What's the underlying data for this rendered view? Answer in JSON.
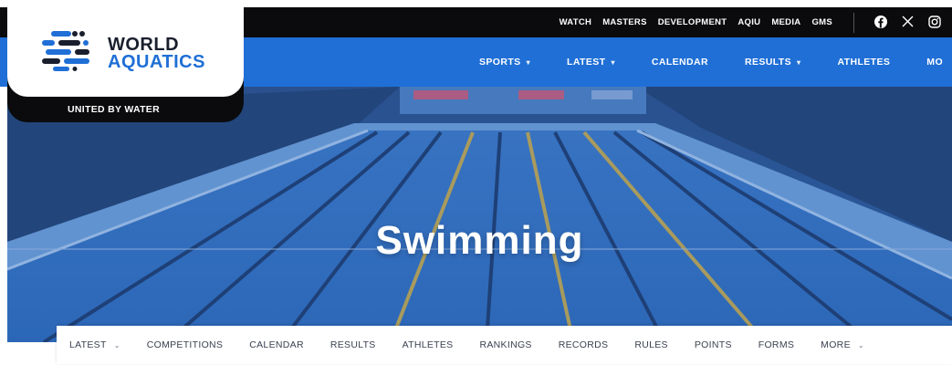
{
  "brand": {
    "name_line1": "WORLD",
    "name_line2": "AQUATICS",
    "tagline": "UNITED BY WATER"
  },
  "top_links": [
    "WATCH",
    "MASTERS",
    "DEVELOPMENT",
    "AQIU",
    "MEDIA",
    "GMS"
  ],
  "social": [
    {
      "name": "facebook-icon",
      "glyph": "f"
    },
    {
      "name": "x-icon",
      "glyph": "𝕏"
    },
    {
      "name": "instagram-icon",
      "glyph": "◎"
    }
  ],
  "main_nav": {
    "sports": "SPORTS",
    "latest": "LATEST",
    "calendar": "CALENDAR",
    "results": "RESULTS",
    "athletes": "ATHLETES",
    "more": "MO"
  },
  "hero": {
    "title": "Swimming"
  },
  "sub_nav": {
    "latest": "LATEST",
    "competitions": "COMPETITIONS",
    "calendar": "CALENDAR",
    "results": "RESULTS",
    "athletes": "ATHLETES",
    "rankings": "RANKINGS",
    "records": "RECORDS",
    "rules": "RULES",
    "points": "POINTS",
    "forms": "FORMS",
    "more": "MORE"
  },
  "colors": {
    "brand_blue": "#1f6fd6",
    "dark": "#0b0b0d",
    "pool_blue": "#2b5fa3"
  }
}
